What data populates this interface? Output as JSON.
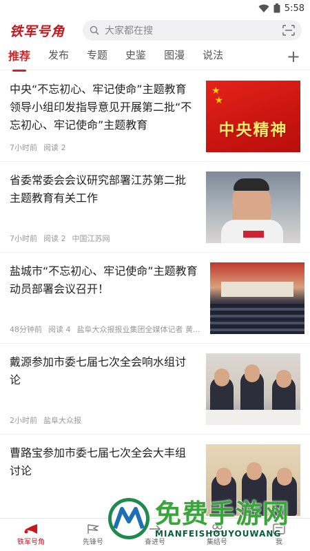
{
  "status": {
    "time": "5:58"
  },
  "header": {
    "logo": "铁军号角",
    "search_placeholder": "大家都在搜"
  },
  "tabs": [
    {
      "label": "推荐",
      "active": true
    },
    {
      "label": "发布"
    },
    {
      "label": "专题"
    },
    {
      "label": "史鉴"
    },
    {
      "label": "图漫"
    },
    {
      "label": "说法"
    }
  ],
  "feed": [
    {
      "title": "中央“不忘初心、牢记使命”主题教育领导小组印发指导意见开展第二批“不忘初心、牢记使命”主题教育",
      "time": "7小时前",
      "reads": "阅读 2",
      "source": "",
      "thumb_text": "中央精神"
    },
    {
      "title": "省委常委会会议研究部署江苏第二批主题教育有关工作",
      "time": "7小时前",
      "reads": "阅读 2",
      "source": "中国江苏网"
    },
    {
      "title": "盐城市“不忘初心、牢记使命”主题教育动员部署会议召开！",
      "time": "48分钟前",
      "reads": "阅读 4",
      "source": "盐阜大众报报业集团全媒体记者 黄..."
    },
    {
      "title": "戴源参加市委七届七次全会响水组讨论",
      "time": "2小时前",
      "reads": "",
      "source": "盐阜大众报"
    },
    {
      "title": "曹路宝参加市委七届七次全会大丰组讨论",
      "time": "",
      "reads": "",
      "source": ""
    }
  ],
  "bottom_nav": [
    {
      "label": "铁军号角",
      "active": true
    },
    {
      "label": "先锋号"
    },
    {
      "label": "奋进号"
    },
    {
      "label": "集结号"
    },
    {
      "label": "我"
    }
  ],
  "watermark": {
    "title": "免费手游网",
    "subtitle": "MIANFEISHOUYOUWANG"
  },
  "colors": {
    "accent": "#d42222",
    "brand": "#c8161d"
  }
}
